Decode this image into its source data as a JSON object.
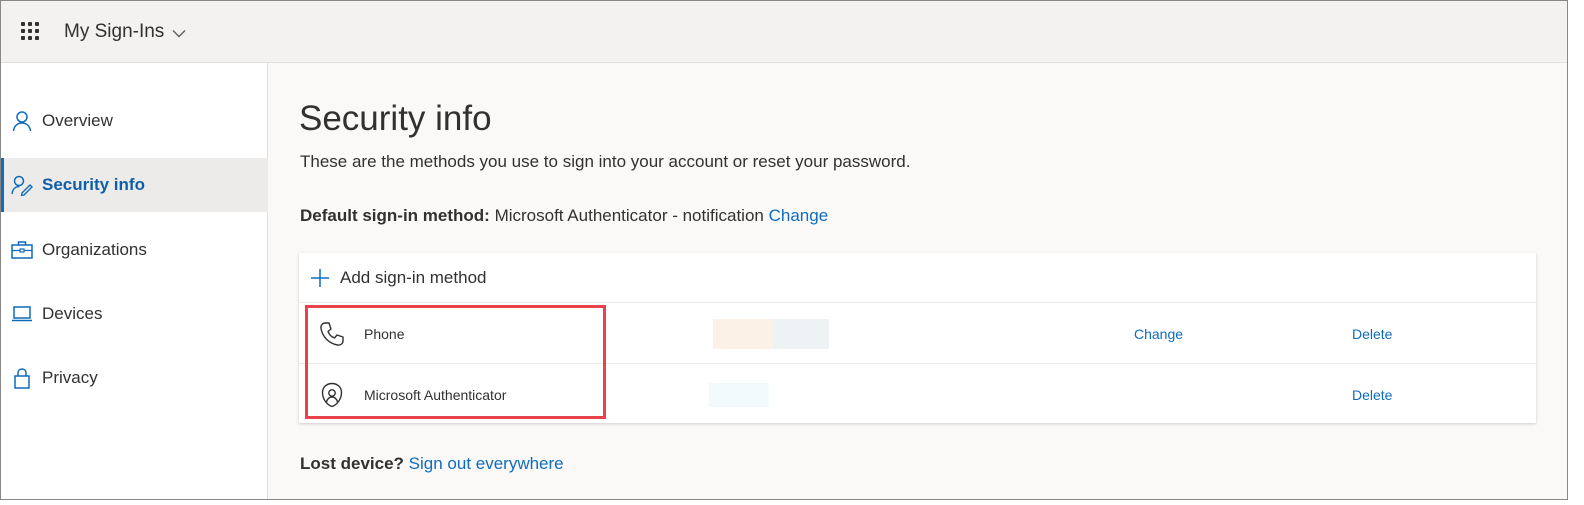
{
  "header": {
    "app_title": "My Sign-Ins",
    "waffle_icon": "waffle-grid-icon",
    "title_chevron_icon": "chevron-down-icon"
  },
  "sidebar": {
    "items": [
      {
        "label": "Overview",
        "icon": "person-icon",
        "active": false
      },
      {
        "label": "Security info",
        "icon": "person-key-icon",
        "active": true
      },
      {
        "label": "Organizations",
        "icon": "briefcase-icon",
        "active": false
      },
      {
        "label": "Devices",
        "icon": "laptop-icon",
        "active": false
      },
      {
        "label": "Privacy",
        "icon": "lock-icon",
        "active": false
      }
    ]
  },
  "main": {
    "title": "Security info",
    "subtitle": "These are the methods you use to sign into your account or reset your password.",
    "default_method": {
      "label": "Default sign-in method:",
      "value": "Microsoft Authenticator - notification",
      "change_link": "Change"
    },
    "add_method_label": "Add sign-in method",
    "methods": [
      {
        "name": "Phone",
        "icon": "phone-icon",
        "change_label": "Change",
        "delete_label": "Delete"
      },
      {
        "name": "Microsoft Authenticator",
        "icon": "authenticator-icon",
        "delete_label": "Delete"
      }
    ],
    "lost_device": {
      "label": "Lost device?",
      "link": "Sign out everywhere"
    }
  },
  "colors": {
    "accent": "#0f6cbd",
    "highlight_box": "#e8424a",
    "header_bg": "#f3f2f1",
    "content_bg": "#faf9f8"
  }
}
